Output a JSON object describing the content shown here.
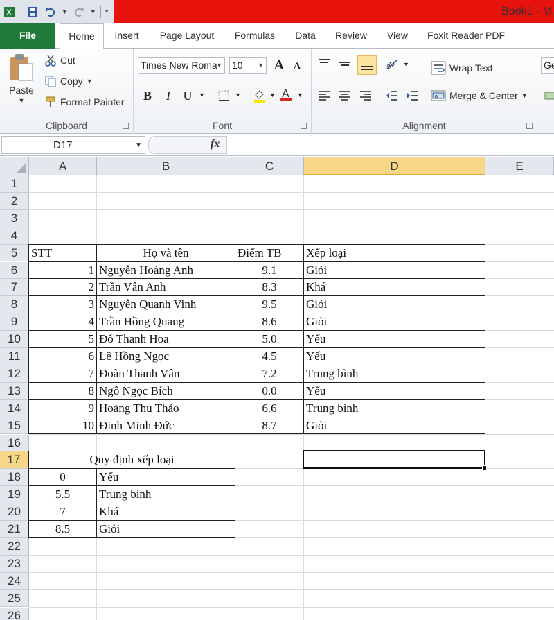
{
  "window": {
    "title": "Book1 - M"
  },
  "tabs": [
    "File",
    "Home",
    "Insert",
    "Page Layout",
    "Formulas",
    "Data",
    "Review",
    "View",
    "Foxit Reader PDF"
  ],
  "ribbon": {
    "clipboard": {
      "paste": "Paste",
      "cut": "Cut",
      "copy": "Copy",
      "format_painter": "Format Painter",
      "label": "Clipboard"
    },
    "font": {
      "font_name": "Times New Roma",
      "font_size": "10",
      "label": "Font",
      "bold": "B",
      "italic": "I",
      "underline": "U",
      "grow": "A",
      "shrink": "A"
    },
    "alignment": {
      "wrap_text": "Wrap Text",
      "merge_center": "Merge & Center",
      "label": "Alignment"
    },
    "number": {
      "format": "Ge"
    }
  },
  "formula_bar": {
    "name_box": "D17",
    "fx": "fx",
    "content": ""
  },
  "columns": [
    "A",
    "B",
    "C",
    "D",
    "E"
  ],
  "rows": [
    "1",
    "2",
    "3",
    "4",
    "5",
    "6",
    "7",
    "8",
    "9",
    "10",
    "11",
    "12",
    "13",
    "14",
    "15",
    "16",
    "17",
    "18",
    "19",
    "20",
    "21",
    "22",
    "23",
    "24",
    "25",
    "26"
  ],
  "selected_cell": "D17",
  "sheet": {
    "table_header": {
      "stt": "STT",
      "name": "Họ và tên",
      "score": "Điểm TB",
      "rank": "Xếp loại"
    },
    "students": [
      {
        "stt": "1",
        "name": "Nguyễn Hoàng Anh",
        "score": "9.1",
        "rank": "Giỏi"
      },
      {
        "stt": "2",
        "name": "Trần Vân Anh",
        "score": "8.3",
        "rank": "Khá"
      },
      {
        "stt": "3",
        "name": "Nguyễn Quanh Vinh",
        "score": "9.5",
        "rank": "Giỏi"
      },
      {
        "stt": "4",
        "name": "Trần Hồng Quang",
        "score": "8.6",
        "rank": "Giỏi"
      },
      {
        "stt": "5",
        "name": "Đỗ Thanh Hoa",
        "score": "5.0",
        "rank": "Yếu"
      },
      {
        "stt": "6",
        "name": "Lê Hồng Ngọc",
        "score": "4.5",
        "rank": "Yếu"
      },
      {
        "stt": "7",
        "name": "Đoàn Thanh Vân",
        "score": "7.2",
        "rank": "Trung bình"
      },
      {
        "stt": "8",
        "name": "Ngô Ngọc Bích",
        "score": "0.0",
        "rank": "Yếu"
      },
      {
        "stt": "9",
        "name": "Hoàng Thu Thảo",
        "score": "6.6",
        "rank": "Trung bình"
      },
      {
        "stt": "10",
        "name": "Đinh Minh Đức",
        "score": "8.7",
        "rank": "Giỏi"
      }
    ],
    "rules_title": "Quy định xếp loại",
    "rules": [
      {
        "min": "0",
        "rank": "Yếu"
      },
      {
        "min": "5.5",
        "rank": "Trung bình"
      },
      {
        "min": "7",
        "rank": "Khá"
      },
      {
        "min": "8.5",
        "rank": "Giỏi"
      }
    ]
  },
  "colors": {
    "file_tab": "#1f7a3a",
    "title_red": "#e8120c",
    "header_active": "#f7d688"
  }
}
